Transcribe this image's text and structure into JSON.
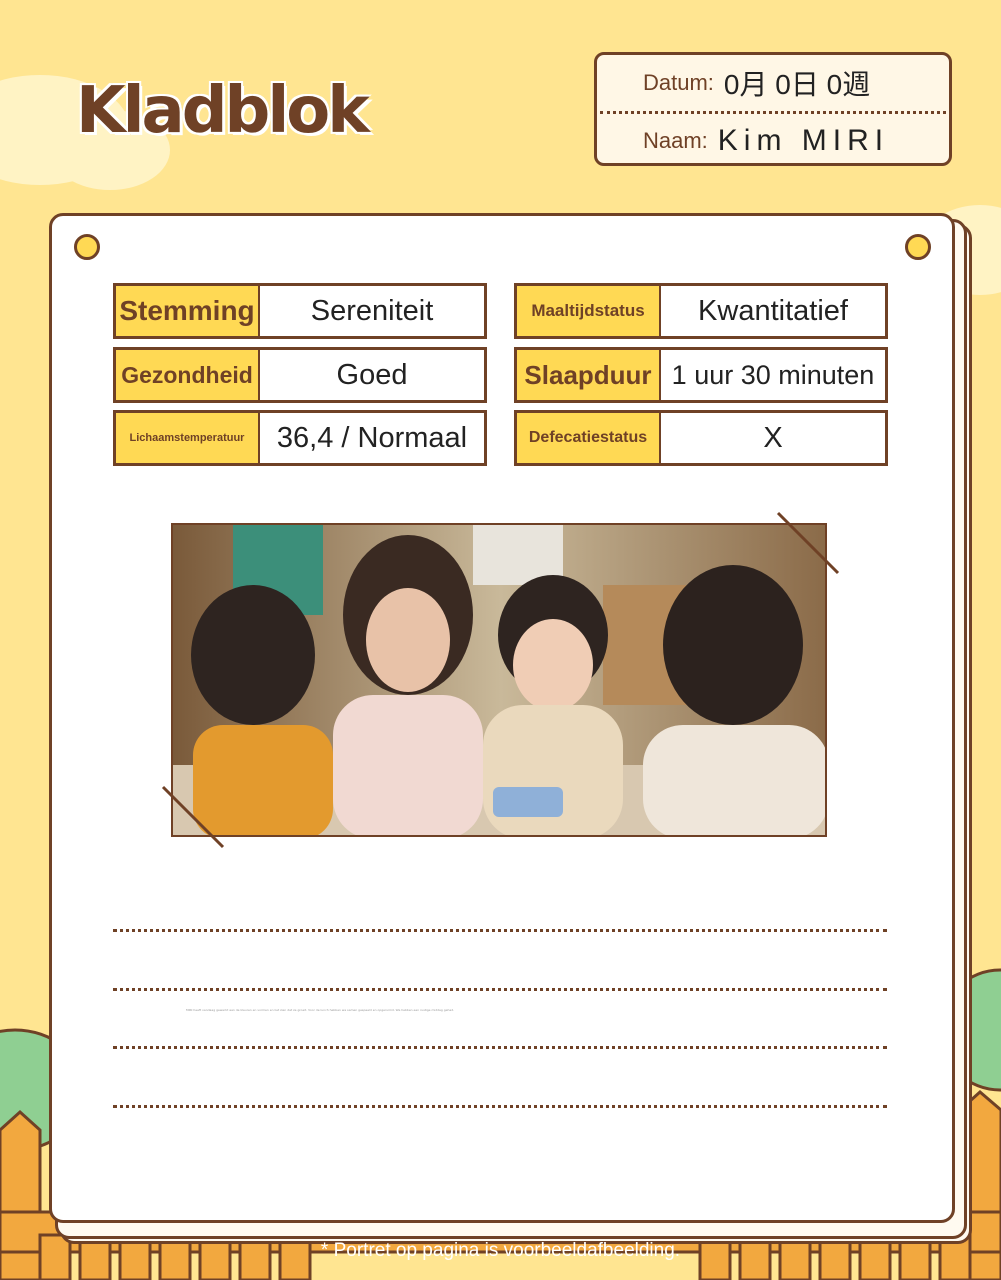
{
  "header": {
    "title": "Kladblok"
  },
  "datebox": {
    "date_label": "Datum:",
    "date_value": "0月 0日 0週",
    "name_label": "Naam:",
    "name_value": "Kim MIRI"
  },
  "fields": [
    {
      "label": "Stemming",
      "value": "Sereniteit"
    },
    {
      "label": "Maaltijdstatus",
      "value": "Kwantitatief"
    },
    {
      "label": "Gezondheid",
      "value": "Goed"
    },
    {
      "label": "Slaapduur",
      "value": "1 uur 30 minuten"
    },
    {
      "label": "Lichaamstemperatuur",
      "value": "36,4 / Normaal"
    },
    {
      "label": "Defecatiestatus",
      "value": "X"
    }
  ],
  "fine_print": "MIRI heeft vandaag gewerkt aan de kleuren en vormen en liet zien dat ze groeit. Voor de lunch hebben we samen gespeeld en opgeruimd. We hebben een rustige middag gehad.",
  "footer": {
    "note": "* Portret op pagina is voorbeeldafbeelding."
  },
  "colors": {
    "background": "#ffe591",
    "brown": "#6f4126",
    "label_yellow": "#ffd954",
    "fence": "#f2a83f",
    "bush": "#8fcf92"
  }
}
